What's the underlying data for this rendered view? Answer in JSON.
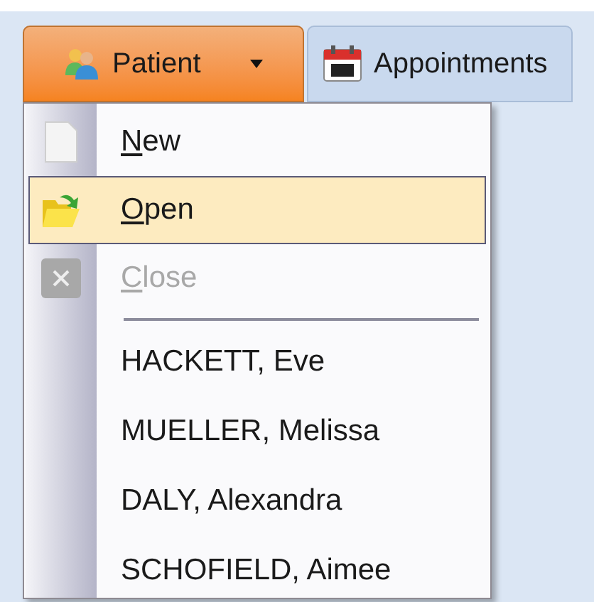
{
  "toolbar": [
    {
      "label": "Patient",
      "expanded": true,
      "has_dropdown": true
    },
    {
      "label": "Appointments",
      "expanded": false,
      "has_dropdown": false
    }
  ],
  "menu": {
    "commands": [
      {
        "label": "New",
        "underline_first": true,
        "selected": false,
        "disabled": false
      },
      {
        "label": "Open",
        "underline_first": true,
        "selected": true,
        "disabled": false
      },
      {
        "label": "Close",
        "underline_first": true,
        "selected": false,
        "disabled": true
      }
    ],
    "recent": [
      {
        "label": "HACKETT, Eve",
        "selected": false
      },
      {
        "label": "MUELLER, Melissa",
        "selected": false
      },
      {
        "label": "DALY, Alexandra",
        "selected": false
      },
      {
        "label": "SCHOFIELD, Aimee",
        "selected": false
      }
    ]
  }
}
